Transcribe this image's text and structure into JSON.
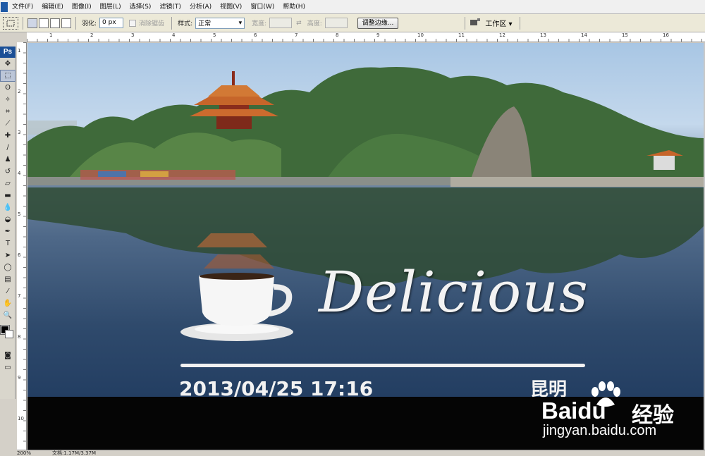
{
  "menu": {
    "items": [
      "文件(F)",
      "编辑(E)",
      "图像(I)",
      "图层(L)",
      "选择(S)",
      "滤镜(T)",
      "分析(A)",
      "视图(V)",
      "窗口(W)",
      "帮助(H)"
    ]
  },
  "options": {
    "feather_label": "羽化:",
    "feather_value": "0 px",
    "antialias_label": "消除锯齿",
    "style_label": "样式:",
    "style_value": "正常",
    "width_label": "宽度:",
    "height_label": "高度:",
    "refine_edge_button": "调整边缘...",
    "workspace_label": "工作区 ▾"
  },
  "toolbox": {
    "logo": "Ps"
  },
  "ruler": {
    "top_numbers": [
      "1",
      "2",
      "3",
      "4",
      "5",
      "6",
      "7",
      "8",
      "9",
      "10",
      "11",
      "12",
      "13",
      "14",
      "15",
      "16"
    ],
    "left_numbers": [
      "1",
      "2",
      "3",
      "4",
      "5",
      "6",
      "7",
      "8",
      "9",
      "10"
    ]
  },
  "canvas": {
    "headline": "Delicious",
    "datetime": "2013/04/25 17:16",
    "city": "昆明"
  },
  "watermark": {
    "brand": "Bai",
    "brand_suffix": "du",
    "cn": "经验",
    "url": "jingyan.baidu.com"
  },
  "status": {
    "zoom": "200%",
    "doc_info": "文档:1.17M/3.37M"
  },
  "colors": {
    "ps_blue": "#1b4f96",
    "foreground": "#000000",
    "background": "#ffffff"
  }
}
